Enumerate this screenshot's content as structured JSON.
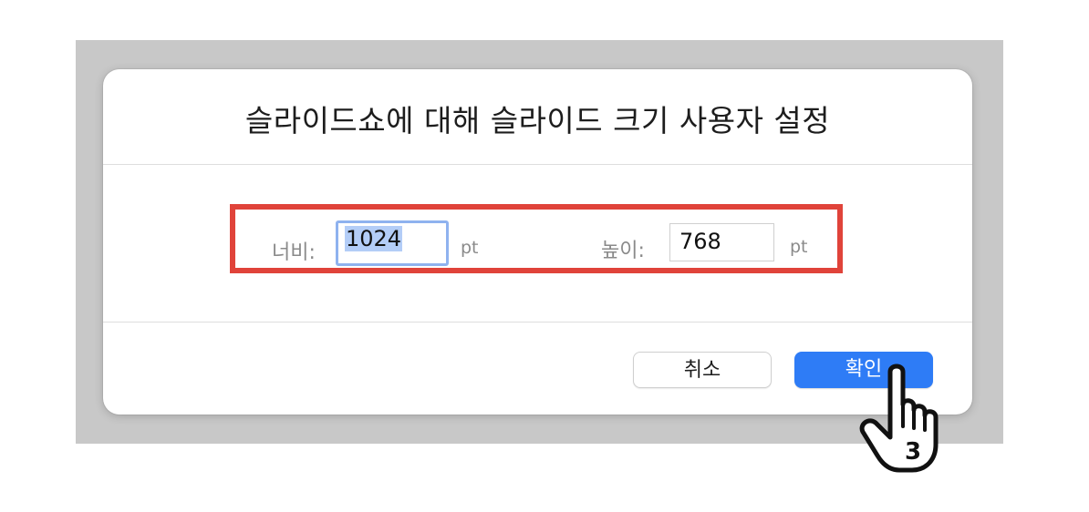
{
  "dialog": {
    "title": "슬라이드쇼에 대해 슬라이드 크기 사용자 설정",
    "width_label": "너비:",
    "width_value": "1024",
    "width_unit": "pt",
    "height_label": "높이:",
    "height_value": "768",
    "height_unit": "pt",
    "cancel_label": "취소",
    "ok_label": "확인"
  },
  "annotation": {
    "step_number": "3",
    "highlight_color": "#e0433a"
  },
  "colors": {
    "accent": "#2e7cf6",
    "focus_ring": "#8fb2ef",
    "selection": "#b3cdf7"
  }
}
